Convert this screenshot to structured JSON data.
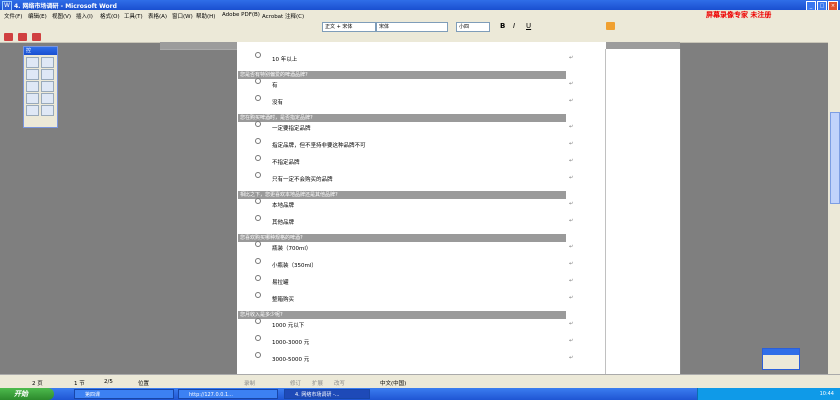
{
  "window": {
    "title": "4. 网络市场调研 - Microsoft Word"
  },
  "menu": [
    "文件(F)",
    "编辑(E)",
    "视图(V)",
    "插入(I)",
    "格式(O)",
    "工具(T)",
    "表格(A)",
    "窗口(W)",
    "帮助(H)",
    "Adobe PDF(B)",
    "Acrobat 注释(C)"
  ],
  "watermark": "屏幕录像专家 未注册",
  "format_bar": {
    "style": "正文 + 宋体",
    "font": "宋体",
    "size": "小四"
  },
  "left_toolbox": {
    "title": "控"
  },
  "survey": {
    "items": [
      {
        "type": "option",
        "text": "10 年以上"
      },
      {
        "type": "question",
        "text": "您是否有特别偏爱的啤酒品牌?"
      },
      {
        "type": "option",
        "text": "有"
      },
      {
        "type": "option",
        "text": "没有"
      },
      {
        "type": "question",
        "text": "您在购买啤酒时，是否指定品牌?"
      },
      {
        "type": "option",
        "text": "一定要指定品牌"
      },
      {
        "type": "option",
        "text": "指定品牌，但不坚持非要这种品牌不可"
      },
      {
        "type": "option",
        "text": "不指定品牌"
      },
      {
        "type": "option",
        "text": "只有一定不会购买的品牌"
      },
      {
        "type": "question",
        "text": "相比之下，您更喜欢本地品牌还是其他品牌?"
      },
      {
        "type": "option",
        "text": "本地品牌"
      },
      {
        "type": "option",
        "text": "其他品牌"
      },
      {
        "type": "question",
        "text": "您喜欢购买哪种规格的啤酒?"
      },
      {
        "type": "option",
        "text": "瓶装（700ml）"
      },
      {
        "type": "option",
        "text": "小瓶装（350ml）"
      },
      {
        "type": "option",
        "text": "易拉罐"
      },
      {
        "type": "option",
        "text": "整箱购买"
      },
      {
        "type": "question",
        "text": "您月收入是多少呢?"
      },
      {
        "type": "option",
        "text": "1000 元以下"
      },
      {
        "type": "option",
        "text": "1000-3000 元"
      },
      {
        "type": "option",
        "text": "3000-5000 元"
      }
    ]
  },
  "statusbar": {
    "page": "2 页",
    "section": "1 节",
    "pages": "2/5",
    "at": "位置",
    "rec": "录制",
    "trk": "修订",
    "ext": "扩展",
    "ovr": "改写",
    "lang": "中文(中国)"
  },
  "taskbar": {
    "start": "开始",
    "tasks": [
      "第四课",
      "http://127.0.0.1...",
      "4. 网络市场调研 -..."
    ],
    "clock": "10:44"
  }
}
